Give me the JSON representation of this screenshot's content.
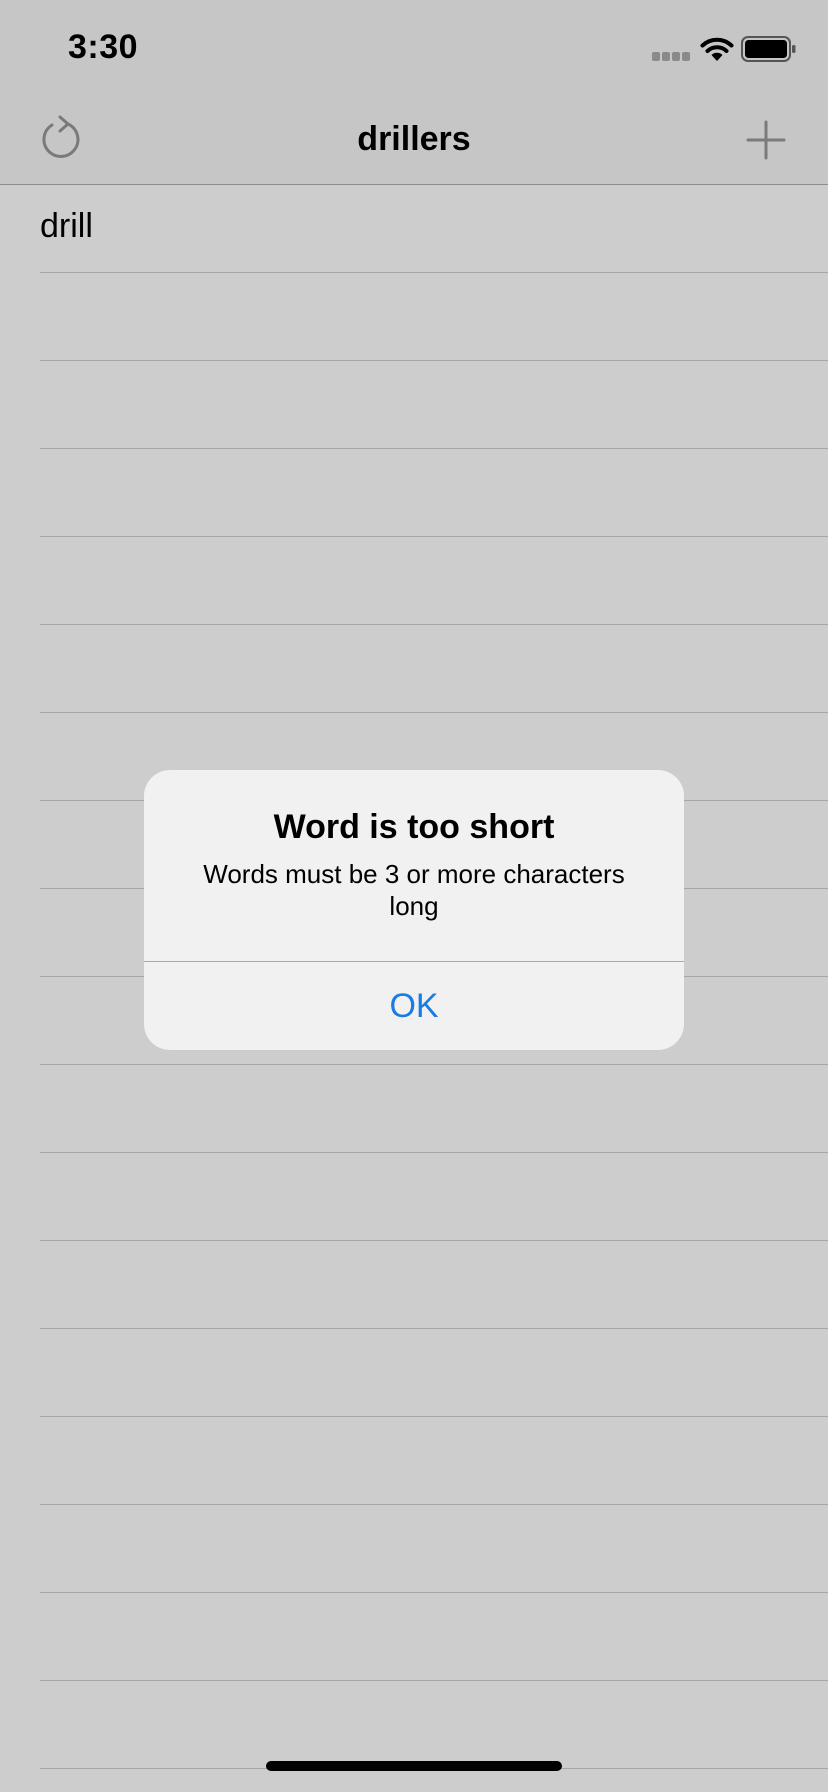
{
  "status_bar": {
    "time": "3:30",
    "icons": [
      "cellular-signal-icon",
      "wifi-icon",
      "battery-icon"
    ]
  },
  "nav_bar": {
    "title": "drillers",
    "left_icon": "refresh-icon",
    "right_icon": "plus-icon"
  },
  "list": {
    "rows": [
      "drill",
      "",
      "",
      "",
      "",
      "",
      "",
      "",
      "",
      "",
      "",
      "",
      "",
      "",
      "",
      "",
      "",
      ""
    ]
  },
  "alert": {
    "title": "Word is too short",
    "message": "Words must be 3 or more characters long",
    "ok_label": "OK"
  },
  "colors": {
    "background": "#cdcdcd",
    "bar_background": "#c6c6c6",
    "alert_background": "#f1f1f1",
    "accent": "#1a7be3"
  }
}
